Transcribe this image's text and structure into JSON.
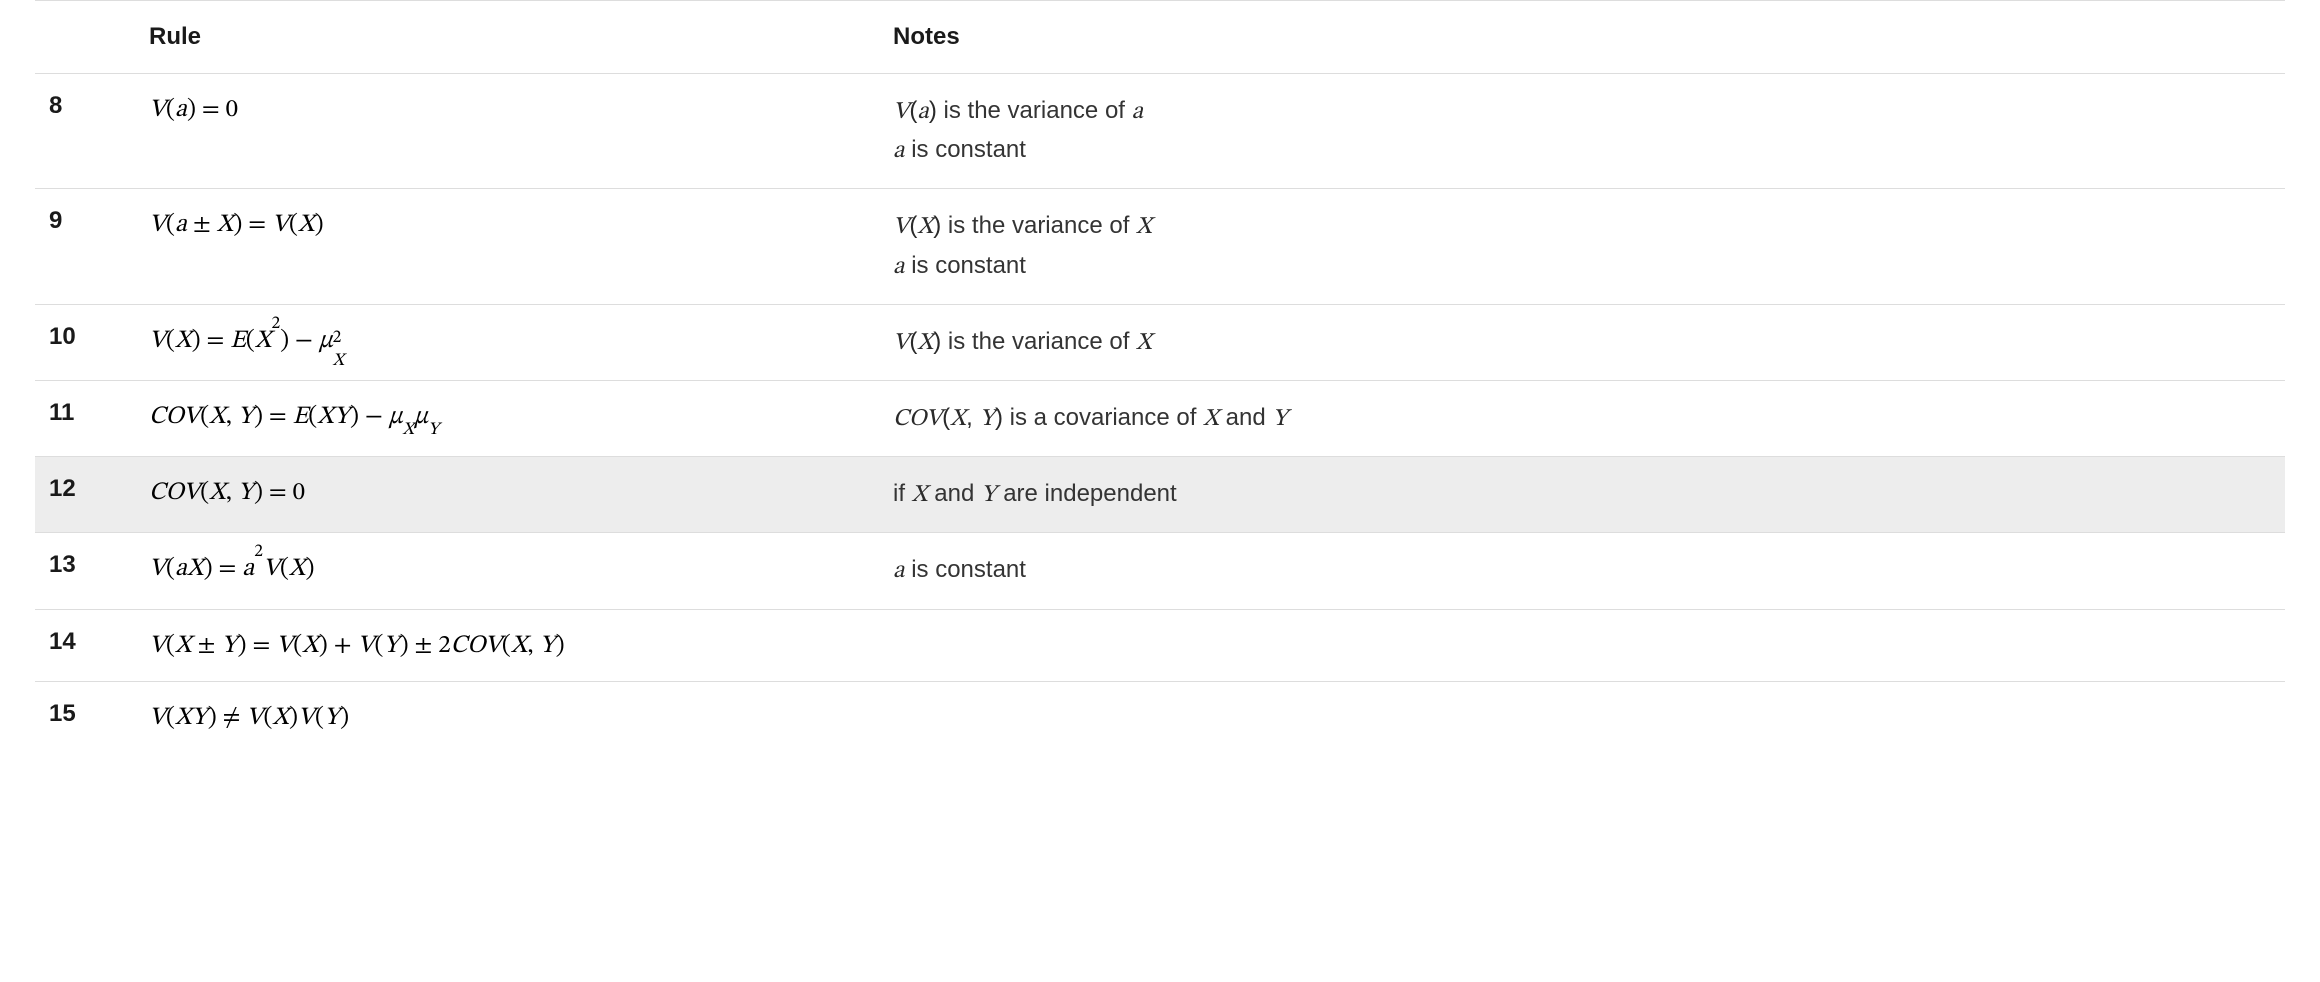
{
  "headers": {
    "number": "",
    "rule": "Rule",
    "notes": "Notes"
  },
  "highlight_row_index": 4,
  "rows": [
    {
      "n": "8",
      "rule_html": "<span class='op'>V</span>(<span class='m'>a</span>) = <span class='mn'>0</span>",
      "notes_html": "<span class='op'>V</span>(<span class='m'>a</span>)<span class='txt'> is the variance of </span><span class='m'>a</span><br><span class='m'>a</span><span class='txt'> is constant</span>"
    },
    {
      "n": "9",
      "rule_html": "<span class='op'>V</span>(<span class='m'>a</span> &plusmn; <span class='m'>X</span>) = <span class='op'>V</span>(<span class='m'>X</span>)",
      "notes_html": "<span class='op'>V</span>(<span class='m'>X</span>)<span class='txt'> is the variance of </span><span class='m'>X</span><br><span class='m'>a</span><span class='txt'> is constant</span>"
    },
    {
      "n": "10",
      "rule_html": "<span class='op'>V</span>(<span class='m'>X</span>) = <span class='op'>E</span>(<span class='m'>X</span><sup class='mn'>2</sup>) &minus; <span class='m'>&mu;</span><span class='supsub'><span class='ss-sup mn'>2</span><span class='ss-sub'>X</span></span>",
      "notes_html": "<span class='op'>V</span>(<span class='m'>X</span>)<span class='txt'> is the variance of </span><span class='m'>X</span>"
    },
    {
      "n": "11",
      "rule_html": "<span class='op'>COV</span>(<span class='m'>X</span>, <span class='m'>Y</span>) = <span class='op'>E</span>(<span class='m'>XY</span>) &minus; <span class='m'>&mu;</span><sub class='m'>X</sub><span class='m'>&mu;</span><sub class='m'>Y</sub>",
      "notes_html": "<span class='op'>COV</span>(<span class='m'>X</span>, <span class='m'>Y</span>)<span class='txt'> is a covariance of </span><span class='m'>X</span><span class='txt'> and </span><span class='m'>Y</span>"
    },
    {
      "n": "12",
      "rule_html": "<span class='op'>COV</span>(<span class='m'>X</span>, <span class='m'>Y</span>) = <span class='mn'>0</span>",
      "notes_html": "<span class='txt'>if </span><span class='m'>X</span><span class='txt'> and </span><span class='m'>Y</span><span class='txt'> are independent</span>"
    },
    {
      "n": "13",
      "rule_html": "<span class='op'>V</span>(<span class='m'>aX</span>) = <span class='m'>a</span><sup class='mn'>2</sup><span class='op'>V</span>(<span class='m'>X</span>)",
      "notes_html": "<span class='m'>a</span><span class='txt'> is constant</span>"
    },
    {
      "n": "14",
      "rule_html": "<span class='op'>V</span>(<span class='m'>X</span> &plusmn; <span class='m'>Y</span>) = <span class='op'>V</span>(<span class='m'>X</span>) + <span class='op'>V</span>(<span class='m'>Y</span>) &plusmn; <span class='mn'>2</span><span class='op'>COV</span>(<span class='m'>X</span>, <span class='m'>Y</span>)",
      "notes_html": ""
    },
    {
      "n": "15",
      "rule_html": "<span class='op'>V</span>(<span class='m'>XY</span>) &ne; <span class='op'>V</span>(<span class='m'>X</span>)<span class='op'>V</span>(<span class='m'>Y</span>)",
      "notes_html": ""
    }
  ]
}
